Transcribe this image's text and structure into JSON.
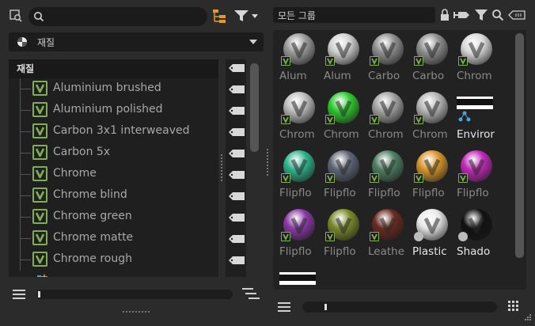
{
  "left_panel": {
    "dropdown_label": "재질",
    "tree_header": "재질",
    "materials": [
      "Aluminium brushed",
      "Aluminium polished",
      "Carbon 3x1 interweaved",
      "Carbon 5x",
      "Chrome",
      "Chrome blind",
      "Chrome green",
      "Chrome matte",
      "Chrome rough"
    ]
  },
  "right_panel": {
    "group_filter": "모든 그룹",
    "tiles": [
      {
        "label": "Alum",
        "kind": "sphere",
        "color": "#9a9a9a",
        "bright": false,
        "badge": true
      },
      {
        "label": "Alum",
        "kind": "sphere",
        "color": "#cfcfcf",
        "bright": false,
        "badge": true
      },
      {
        "label": "Carbo",
        "kind": "sphere",
        "color": "#8e8e8e",
        "bright": false,
        "badge": true
      },
      {
        "label": "Carbo",
        "kind": "sphere",
        "color": "#8e8e8e",
        "bright": false,
        "badge": true
      },
      {
        "label": "Chrom",
        "kind": "sphere",
        "color": "#d9d9d9",
        "bright": false,
        "badge": true
      },
      {
        "label": "Chrom",
        "kind": "sphere",
        "color": "#bdbdbd",
        "bright": false,
        "badge": true
      },
      {
        "label": "Chrom",
        "kind": "sphere",
        "color": "#2ec92e",
        "bright": false,
        "badge": true
      },
      {
        "label": "Chrom",
        "kind": "sphere",
        "color": "#a3a3a3",
        "bright": false,
        "badge": true
      },
      {
        "label": "Chrom",
        "kind": "sphere",
        "color": "#b5b5b5",
        "bright": false,
        "badge": true
      },
      {
        "label": "Enviror",
        "kind": "env",
        "color": "#ffffff",
        "bright": true,
        "badge": false
      },
      {
        "label": "Flipflo",
        "kind": "sphere",
        "color": "#2fb38a",
        "bright": false,
        "badge": true
      },
      {
        "label": "Flipflo",
        "kind": "sphere",
        "color": "#5e6675",
        "bright": false,
        "badge": true
      },
      {
        "label": "Flipflo",
        "kind": "sphere",
        "color": "#4e7e62",
        "bright": false,
        "badge": true
      },
      {
        "label": "Flipflo",
        "kind": "sphere",
        "color": "#d7962a",
        "bright": false,
        "badge": true
      },
      {
        "label": "Flipflo",
        "kind": "sphere",
        "color": "#c02ab8",
        "bright": false,
        "badge": true
      },
      {
        "label": "Flipflo",
        "kind": "sphere",
        "color": "#8a3aa5",
        "bright": false,
        "badge": true
      },
      {
        "label": "Flipflo",
        "kind": "sphere",
        "color": "#7a8a2a",
        "bright": false,
        "badge": true
      },
      {
        "label": "Leathe",
        "kind": "sphere",
        "color": "#6a2a22",
        "bright": false,
        "badge": true
      },
      {
        "label": "Plastic",
        "kind": "sphere",
        "color": "#e8e8e8",
        "bright": true,
        "badge": false
      },
      {
        "label": "Shado",
        "kind": "sphere",
        "color": "#111111",
        "bright": true,
        "badge": false
      },
      {
        "label": "",
        "kind": "env2",
        "color": "#ffffff",
        "bright": false,
        "badge": false
      }
    ]
  },
  "icons": {
    "filter_search": "find-material-icon",
    "search": "search-icon",
    "hierarchy": "hierarchy-icon",
    "filter": "filter-icon",
    "lock": "lock-icon",
    "tag": "tag-icon",
    "menu": "menu-icon",
    "grid_view": "grid-view-icon"
  },
  "colors": {
    "accent_orange": "#e49a2a",
    "badge_green": "#7fae54"
  }
}
